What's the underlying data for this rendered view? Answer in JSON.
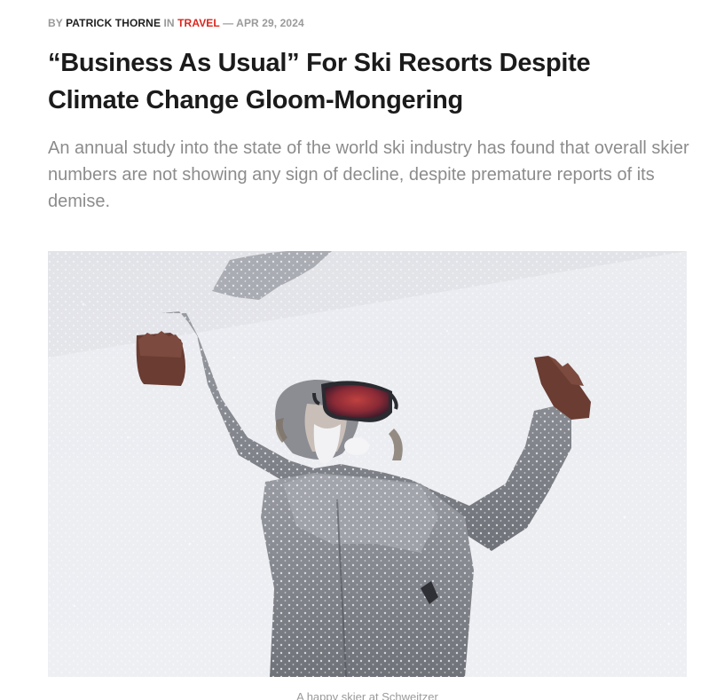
{
  "meta": {
    "by_label": "BY",
    "author": "PATRICK THORNE",
    "in_label": "IN",
    "category": "TRAVEL",
    "separator": "—",
    "date": "APR 29, 2024"
  },
  "article": {
    "title": "“Business As Usual” For Ski Resorts Despite Climate Change Gloom-Mongering",
    "standfirst": "An annual study into the state of the world ski industry has found that overall skier numbers are not showing any sign of decline, despite premature reports of its demise."
  },
  "image": {
    "caption": "A happy skier at Schweitzer"
  },
  "colors": {
    "category": "#d9251d",
    "title": "#1b1b1b",
    "standfirst": "#8c8c8c",
    "meta": "#999999"
  }
}
